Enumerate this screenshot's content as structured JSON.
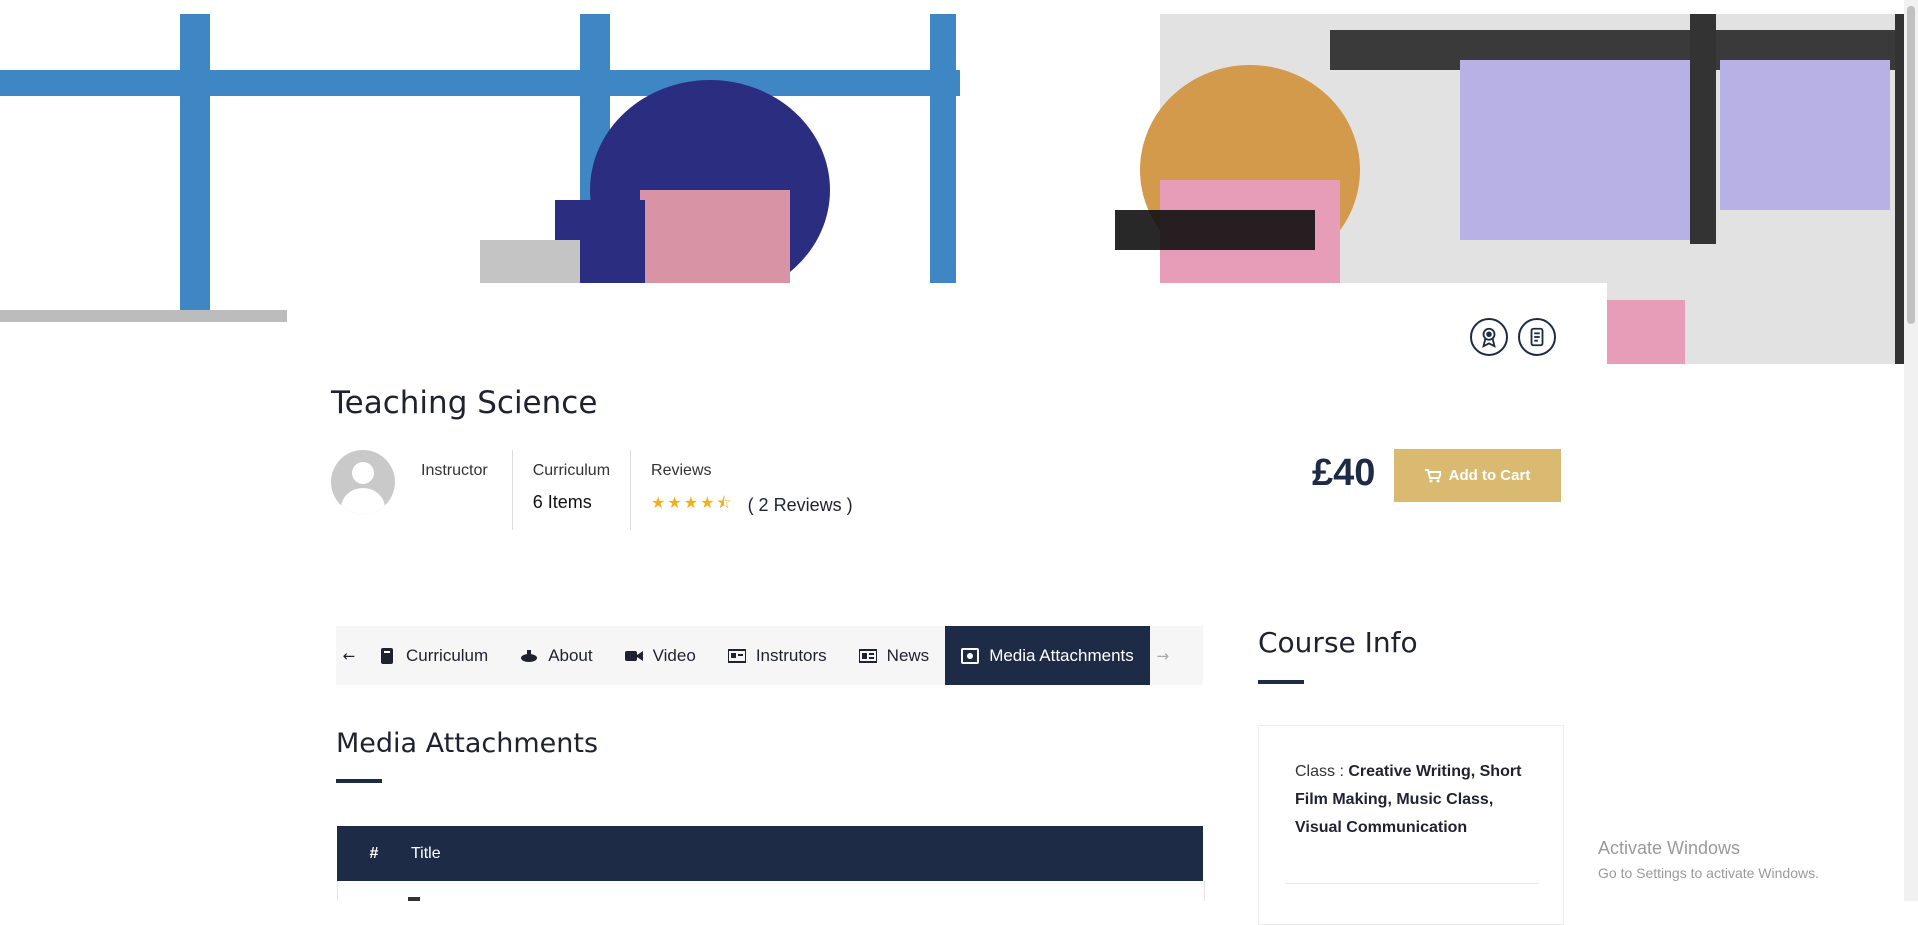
{
  "course": {
    "title": "Teaching Science",
    "instructor_label": "Instructor",
    "curriculum_label": "Curriculum",
    "curriculum_value": "6 Items",
    "reviews_label": "Reviews",
    "stars": "★★★★⯪",
    "rating": 4.5,
    "reviews_value": "( 2 Reviews )",
    "price": "£40",
    "add_to_cart": "Add to Cart"
  },
  "tabs": [
    {
      "label": "Curriculum",
      "icon": "book-icon"
    },
    {
      "label": "About",
      "icon": "about-icon"
    },
    {
      "label": "Video",
      "icon": "video-icon"
    },
    {
      "label": "Instrutors",
      "icon": "id-card-icon"
    },
    {
      "label": "News",
      "icon": "newspaper-icon"
    },
    {
      "label": "Media Attachments",
      "icon": "media-icon",
      "active": true
    }
  ],
  "media": {
    "section_title": "Media Attachments",
    "table_headers": [
      "#",
      "Title"
    ]
  },
  "course_info": {
    "title": "Course Info",
    "class_label": "Class : ",
    "class_value": "Creative Writing, Short Film Making, Music Class, Visual Communication"
  },
  "watermark": {
    "line1": "Activate Windows",
    "line2": "Go to Settings to activate Windows."
  },
  "colors": {
    "navy": "#1d2b47",
    "gold": "#d9ba70",
    "star": "#f2b01e"
  }
}
